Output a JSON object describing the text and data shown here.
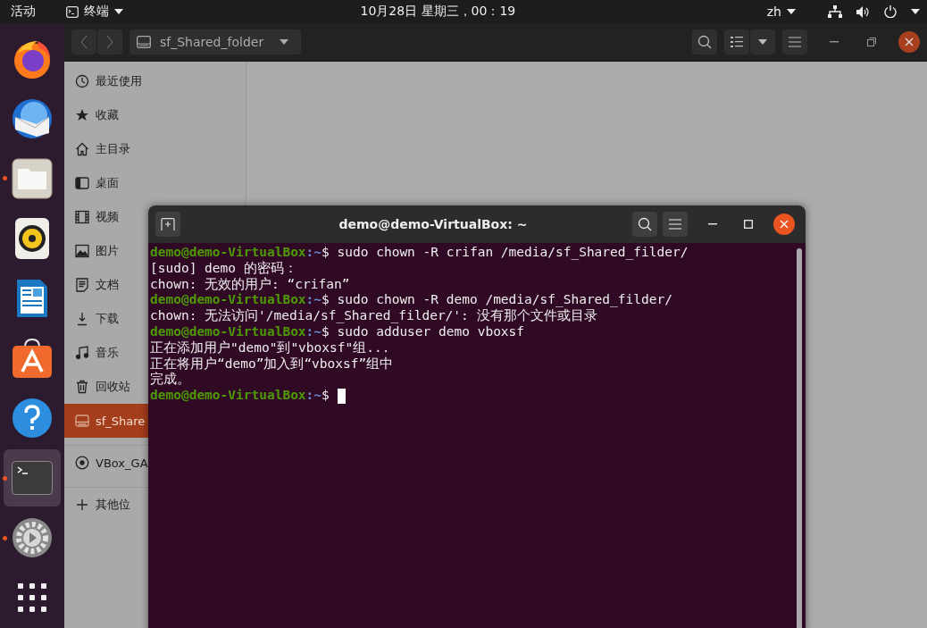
{
  "top_bar": {
    "activities": "活动",
    "app_menu": {
      "label": "终端"
    },
    "clock": "10月28日 星期三，00：19",
    "input_method": "zh"
  },
  "dock": [
    {
      "kind": "browser",
      "running": false,
      "active": false
    },
    {
      "kind": "mail",
      "running": false,
      "active": false
    },
    {
      "kind": "files",
      "running": true,
      "active": false
    },
    {
      "kind": "music",
      "running": false,
      "active": false
    },
    {
      "kind": "writer",
      "running": false,
      "active": false
    },
    {
      "kind": "store",
      "running": false,
      "active": false
    },
    {
      "kind": "help",
      "running": false,
      "active": false
    },
    {
      "kind": "terminal",
      "running": true,
      "active": true
    },
    {
      "kind": "settings",
      "running": true,
      "active": false
    },
    {
      "kind": "apps",
      "running": false,
      "active": false
    }
  ],
  "file_manager": {
    "path_button": "sf_Shared_folder",
    "sidebar": [
      {
        "kind": "recent",
        "label": "最近使用",
        "selected": false
      },
      {
        "kind": "starred",
        "label": "收藏",
        "selected": false
      },
      {
        "kind": "home",
        "label": "主目录",
        "selected": false
      },
      {
        "kind": "desktop",
        "label": "桌面",
        "selected": false
      },
      {
        "kind": "video",
        "label": "视频",
        "selected": false
      },
      {
        "kind": "picture",
        "label": "图片",
        "selected": false
      },
      {
        "kind": "document",
        "label": "文档",
        "selected": false
      },
      {
        "kind": "download",
        "label": "下载",
        "selected": false
      },
      {
        "kind": "music",
        "label": "音乐",
        "selected": false
      },
      {
        "kind": "trash",
        "label": "回收站",
        "selected": false
      },
      {
        "kind": "drive",
        "label": "sf_Share",
        "selected": true
      },
      {
        "kind": "disc",
        "label": "VBox_GA",
        "selected": false,
        "separator_before": true
      },
      {
        "kind": "other",
        "label": "其他位",
        "selected": false,
        "separator_before": true
      }
    ]
  },
  "terminal": {
    "title": "demo@demo-VirtualBox: ~",
    "lines": [
      {
        "kind": "prompt",
        "user": "demo@demo-VirtualBox",
        "path": ":~",
        "command": "$ sudo chown -R crifan /media/sf_Shared_filder/"
      },
      {
        "kind": "output",
        "text": "[sudo] demo 的密码："
      },
      {
        "kind": "output",
        "text": "chown: 无效的用户: “crifan”"
      },
      {
        "kind": "prompt",
        "user": "demo@demo-VirtualBox",
        "path": ":~",
        "command": "$ sudo chown -R demo /media/sf_Shared_filder/"
      },
      {
        "kind": "output",
        "text": "chown: 无法访问'/media/sf_Shared_filder/': 没有那个文件或目录"
      },
      {
        "kind": "prompt",
        "user": "demo@demo-VirtualBox",
        "path": ":~",
        "command": "$ sudo adduser demo vboxsf"
      },
      {
        "kind": "output",
        "text": "正在添加用户\"demo\"到\"vboxsf\"组..."
      },
      {
        "kind": "output",
        "text": "正在将用户“demo”加入到“vboxsf”组中"
      },
      {
        "kind": "output",
        "text": "完成。"
      },
      {
        "kind": "prompt",
        "user": "demo@demo-VirtualBox",
        "path": ":~",
        "command": "$",
        "cursor": true
      }
    ]
  }
}
